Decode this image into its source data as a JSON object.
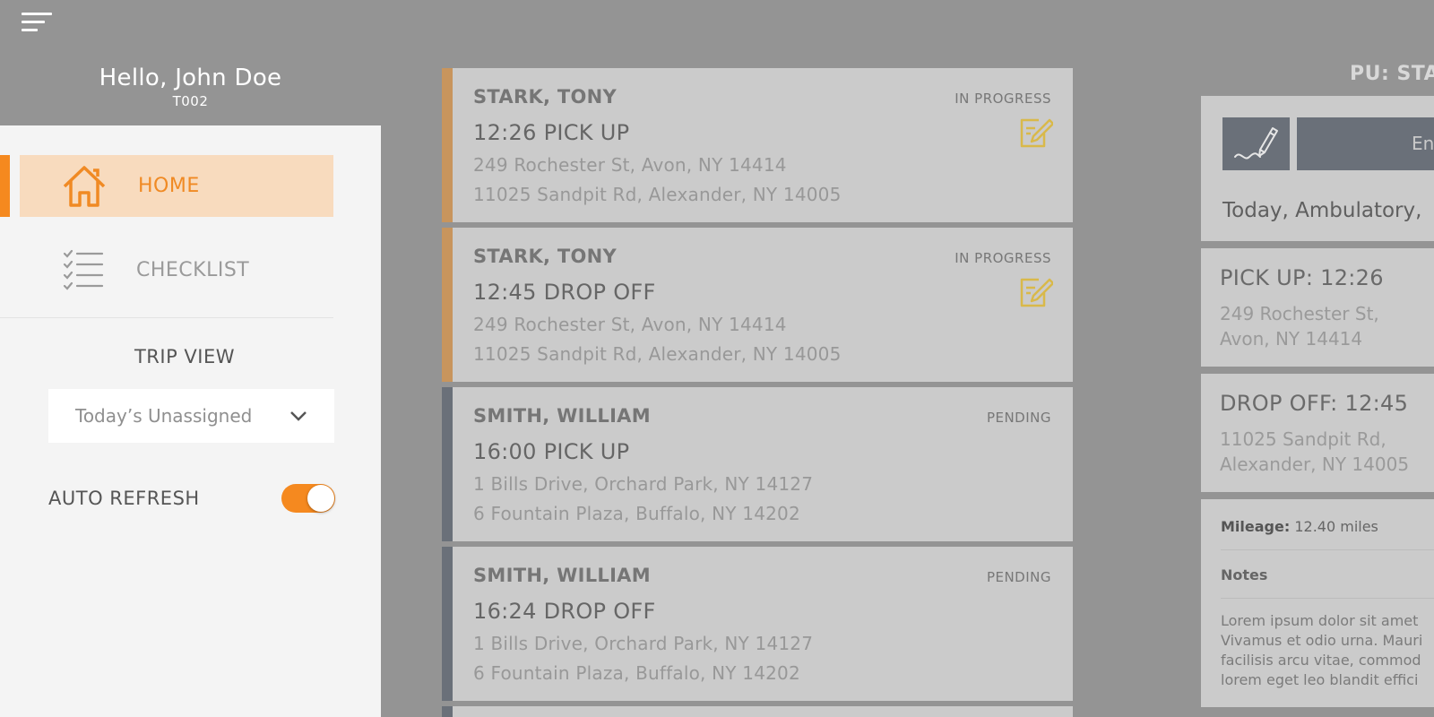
{
  "header": {
    "greeting": "Hello, John Doe",
    "driver_code": "T002"
  },
  "sidebar": {
    "nav": [
      {
        "label": "HOME",
        "icon": "home-icon",
        "active": true
      },
      {
        "label": "CHECKLIST",
        "icon": "checklist-icon",
        "active": false
      }
    ],
    "trip_view_label": "TRIP VIEW",
    "trip_view_selected": "Today’s Unassigned",
    "auto_refresh_label": "AUTO REFRESH",
    "auto_refresh_on": true
  },
  "colors": {
    "accent": "#f5891f",
    "in_progress_bar": "#c8955d",
    "pending_bar": "#6a7079",
    "edit_icon": "#d9b94a"
  },
  "trips": [
    {
      "name": "STARK, TONY",
      "status": "IN PROGRESS",
      "time": "12:26 PICK UP",
      "address_from": "249 Rochester St, Avon, NY 14414",
      "address_to": "11025 Sandpit Rd, Alexander, NY 14005"
    },
    {
      "name": "STARK, TONY",
      "status": "IN PROGRESS",
      "time": "12:45 DROP OFF",
      "address_from": "249 Rochester St, Avon, NY 14414",
      "address_to": "11025 Sandpit Rd, Alexander, NY 14005"
    },
    {
      "name": "SMITH, WILLIAM",
      "status": "PENDING",
      "time": "16:00 PICK UP",
      "address_from": "1 Bills Drive, Orchard Park, NY 14127",
      "address_to": "6 Fountain Plaza, Buffalo, NY 14202"
    },
    {
      "name": "SMITH, WILLIAM",
      "status": "PENDING",
      "time": "16:24 DROP OFF",
      "address_from": "1 Bills Drive, Orchard Park, NY 14127",
      "address_to": "6 Fountain Plaza, Buffalo, NY 14202"
    }
  ],
  "detail": {
    "title": "PU: STA",
    "enter_button_label": "En",
    "summary": "Today, Ambulatory,",
    "pickup_heading": "PICK UP: 12:26",
    "pickup_address": "249 Rochester St, Avon, NY 14414",
    "dropoff_heading": "DROP OFF: 12:45",
    "dropoff_address": "11025 Sandpit Rd, Alexander, NY 14005",
    "mileage_label": "Mileage:",
    "mileage_value": "12.40 miles",
    "notes_label": "Notes",
    "notes_text": "Lorem ipsum dolor sit amet\nVivamus et odio urna. Mauri\nfacilisis arcu vitae, commod\nlorem eget leo blandit effici"
  }
}
